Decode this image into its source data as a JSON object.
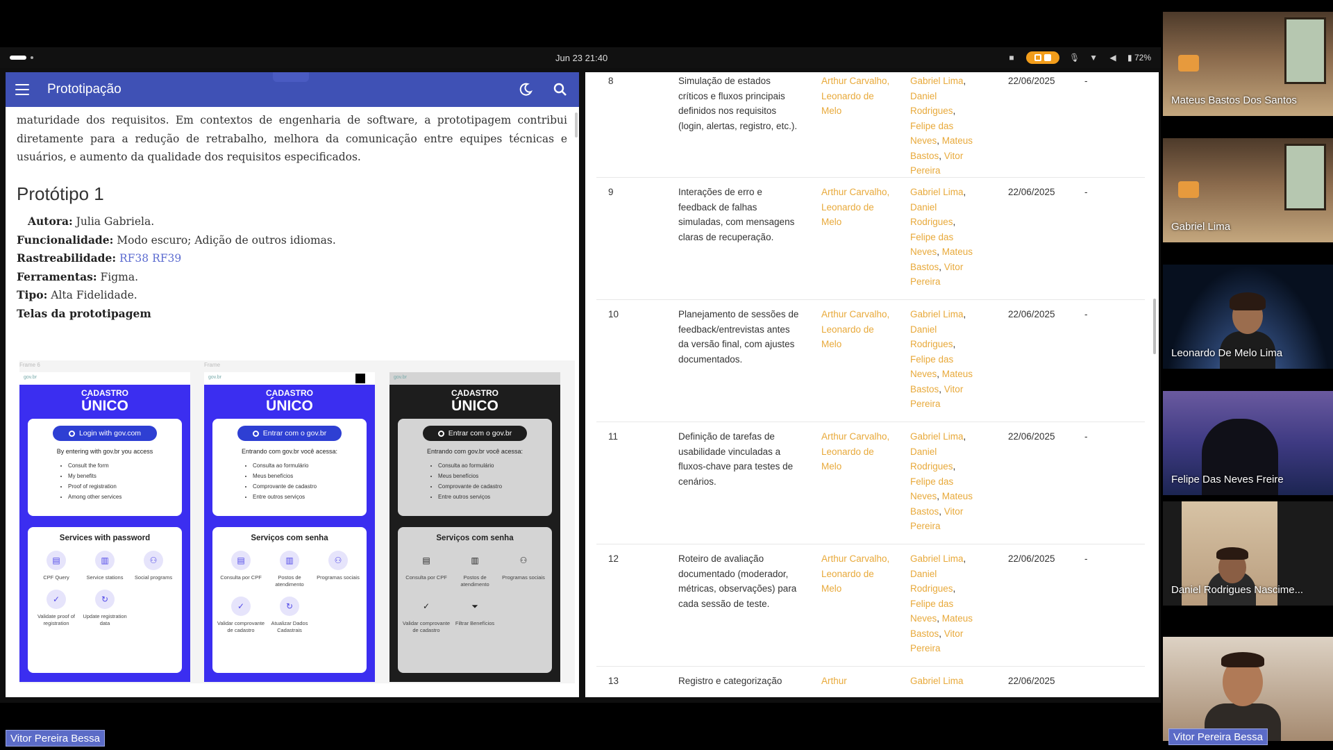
{
  "system_bar": {
    "clock": "Jun 23  21:40",
    "battery": "72%"
  },
  "left_window": {
    "app_title": "Prototipação",
    "intro_paragraph": "maturidade dos requisitos. Em contextos de engenharia de software, a prototipagem contribui diretamente para a redução de retrabalho, melhora da comunicação entre equipes técnicas e usuários, e aumento da qualidade dos requisitos especificados.",
    "section_title": "Protótipo 1",
    "fields": {
      "autora_label": "Autora:",
      "autora_value": "Julia Gabriela.",
      "func_label": "Funcionalidade:",
      "func_value": "Modo escuro; Adição de outros idiomas.",
      "rast_label": "Rastreabilidade:",
      "rast_link1": "RF38",
      "rast_link2": "RF39",
      "ferr_label": "Ferramentas:",
      "ferr_value": "Figma.",
      "tipo_label": "Tipo:",
      "tipo_value": "Alta Fidelidade."
    },
    "screens_title": "Telas da prototipagem",
    "mockups": [
      {
        "frame_label": "Frame 6",
        "logo": "gov.br",
        "header1": "CADASTRO",
        "header2": "ÚNICO",
        "button": "Login with gov.com",
        "desc": "By entering with gov.br you access",
        "items": [
          "Consult the form",
          "My benefits",
          "Proof of registration",
          "Among other services"
        ],
        "services_title": "Services with password",
        "services": [
          "CPF Query",
          "Service stations",
          "Social programs",
          "Validate proof of registration",
          "Update registration data"
        ]
      },
      {
        "frame_label": "Frame",
        "logo": "gov.br",
        "header1": "CADASTRO",
        "header2": "ÚNICO",
        "button": "Entrar com o gov.br",
        "desc": "Entrando com gov.br você acessa:",
        "items": [
          "Consulta ao formulário",
          "Meus benefícios",
          "Comprovante de cadastro",
          "Entre outros serviços"
        ],
        "services_title": "Serviços com senha",
        "services": [
          "Consulta por CPF",
          "Postos de atendimento",
          "Programas sociais",
          "Validar comprovante de cadastro",
          "Atualizar Dados Cadastrais"
        ]
      },
      {
        "frame_label": "",
        "logo": "gov.br",
        "header1": "CADASTRO",
        "header2": "ÚNICO",
        "button": "Entrar com o gov.br",
        "desc": "Entrando com gov.br você acessa:",
        "items": [
          "Consulta ao formulário",
          "Meus benefícios",
          "Comprovante de cadastro",
          "Entre outros serviços"
        ],
        "services_title": "Serviços com senha",
        "services": [
          "Consulta por CPF",
          "Postos de atendimento",
          "Programas sociais",
          "Validar comprovante de cadastro",
          "Filtrar Benefícios"
        ]
      }
    ]
  },
  "table": {
    "rows": [
      {
        "num": "8",
        "desc": "Simulação de estados críticos e fluxos principais definidos nos requisitos (login, alertas, registro, etc.).",
        "authors": "Arthur Carvalho, Leonardo de Melo",
        "reviewers": [
          "Gabriel Lima",
          "Daniel Rodrigues",
          "Felipe das Neves",
          "Mateus Bastos",
          "Vitor Pereira"
        ],
        "date": "22/06/2025",
        "obs": "-"
      },
      {
        "num": "9",
        "desc": "Interações de erro e feedback de falhas simuladas, com mensagens claras de recuperação.",
        "authors": "Arthur Carvalho, Leonardo de Melo",
        "reviewers": [
          "Gabriel Lima",
          "Daniel Rodrigues",
          "Felipe das Neves",
          "Mateus Bastos",
          "Vitor Pereira"
        ],
        "date": "22/06/2025",
        "obs": "-"
      },
      {
        "num": "10",
        "desc": "Planejamento de sessões de feedback/entrevistas antes da versão final, com ajustes documentados.",
        "authors": "Arthur Carvalho, Leonardo de Melo",
        "reviewers": [
          "Gabriel Lima",
          "Daniel Rodrigues",
          "Felipe das Neves",
          "Mateus Bastos",
          "Vitor Pereira"
        ],
        "date": "22/06/2025",
        "obs": "-"
      },
      {
        "num": "11",
        "desc": "Definição de tarefas de usabilidade vinculadas a fluxos-chave para testes de cenários.",
        "authors": "Arthur Carvalho, Leonardo de Melo",
        "reviewers": [
          "Gabriel Lima",
          "Daniel Rodrigues",
          "Felipe das Neves",
          "Mateus Bastos",
          "Vitor Pereira"
        ],
        "date": "22/06/2025",
        "obs": "-"
      },
      {
        "num": "12",
        "desc": "Roteiro de avaliação documentado (moderador, métricas, observações) para cada sessão de teste.",
        "authors": "Arthur Carvalho, Leonardo de Melo",
        "reviewers": [
          "Gabriel Lima",
          "Daniel Rodrigues",
          "Felipe das Neves",
          "Mateus Bastos",
          "Vitor Pereira"
        ],
        "date": "22/06/2025",
        "obs": "-"
      },
      {
        "num": "13",
        "desc": "Registro e categorização",
        "authors": "Arthur",
        "reviewers": [
          "Gabriel Lima"
        ],
        "date": "22/06/2025",
        "obs": ""
      }
    ]
  },
  "participants": [
    "Mateus Bastos Dos Santos",
    "Gabriel Lima",
    "Leonardo De Melo Lima",
    "Felipe Das Neves Freire",
    "Daniel Rodrigues Nascime...",
    "Vitor Pereira Bessa"
  ],
  "presenter": "Vitor Pereira Bessa",
  "self_badge": "Vitor Pereira Bessa"
}
